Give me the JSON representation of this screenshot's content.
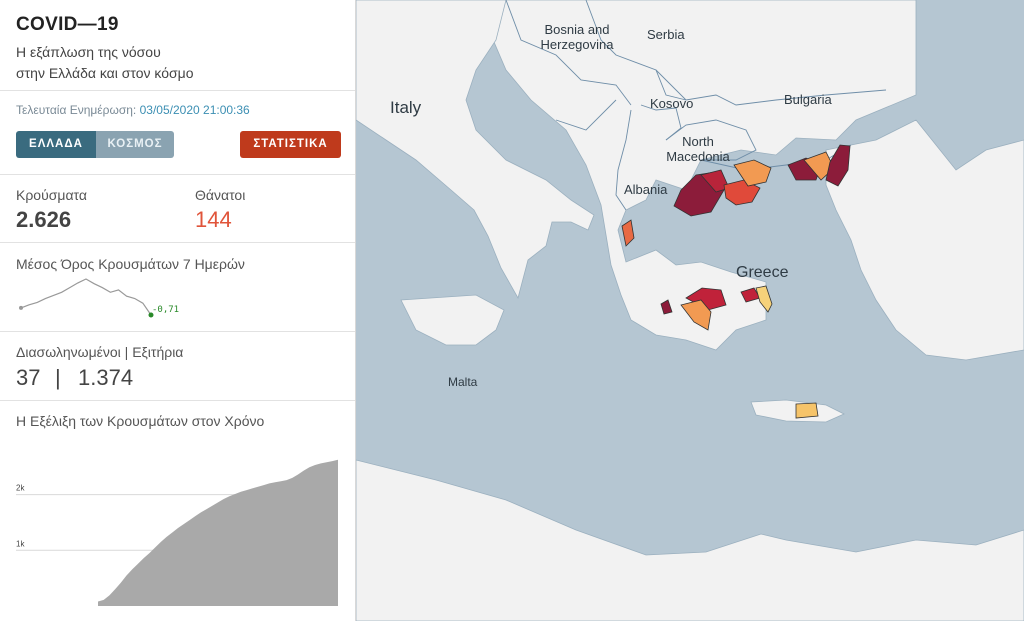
{
  "header": {
    "title": "COVID—19",
    "subtitle_line1": "Η εξάπλωση της νόσου",
    "subtitle_line2": "στην Ελλάδα και στον κόσμο"
  },
  "update": {
    "label": "Τελευταία Ενημέρωση:",
    "value": "03/05/2020 21:00:36"
  },
  "buttons": {
    "greece": "ΕΛΛΑΔΑ",
    "world": "ΚΟΣΜΟΣ",
    "stats": "ΣΤΑΤΙΣΤΙΚΑ"
  },
  "stats": {
    "cases_label": "Κρούσματα",
    "cases_value": "2.626",
    "deaths_label": "Θάνατοι",
    "deaths_value": "144",
    "avg_label": "Μέσος Όρος Κρουσμάτων 7 Ημερών",
    "avg_value": "-0,71",
    "icu_label": "Διασωληνωμένοι | Εξιτήρια",
    "icu_value": "37",
    "separator": "|",
    "discharged_value": "1.374",
    "evolution_label": "Η Εξέλιξη των Κρουσμάτων στον Χρόνο"
  },
  "colors": {
    "primary_button": "#3a6b7f",
    "secondary_button": "#8aa3b1",
    "stats_button": "#bf3a1c",
    "deaths": "#e0543a",
    "sea": "#b5c6d2",
    "land": "#f2f2f2"
  },
  "map": {
    "labels": {
      "bosnia": "Bosnia and Herzegovina",
      "serbia": "Serbia",
      "italy": "Italy",
      "kosovo": "Kosovo",
      "bulgaria": "Bulgaria",
      "north_macedonia": "North Macedonia",
      "albania": "Albania",
      "greece": "Greece",
      "malta": "Malta"
    }
  },
  "chart_data": {
    "type": "area",
    "title": "Η Εξέλιξη των Κρουσμάτων στον Χρόνο",
    "xlabel": "",
    "ylabel": "",
    "ylim": [
      0,
      2800
    ],
    "yticks": [
      "1k",
      "2k"
    ],
    "ytick_values": [
      1000,
      2000
    ],
    "grid": true,
    "values": [
      80,
      110,
      190,
      300,
      420,
      550,
      660,
      760,
      860,
      950,
      1050,
      1150,
      1240,
      1320,
      1400,
      1470,
      1540,
      1610,
      1680,
      1740,
      1800,
      1860,
      1920,
      1970,
      2010,
      2050,
      2080,
      2110,
      2140,
      2170,
      2200,
      2220,
      2240,
      2260,
      2300,
      2360,
      2430,
      2490,
      2530,
      2560,
      2580,
      2600,
      2626
    ]
  },
  "sparkline": {
    "values": [
      0.2,
      0.6,
      0.9,
      1.4,
      1.8,
      2.2,
      2.8,
      3.4,
      3.9,
      3.3,
      2.8,
      2.2,
      2.5,
      1.7,
      1.4,
      0.8,
      -0.71
    ]
  }
}
